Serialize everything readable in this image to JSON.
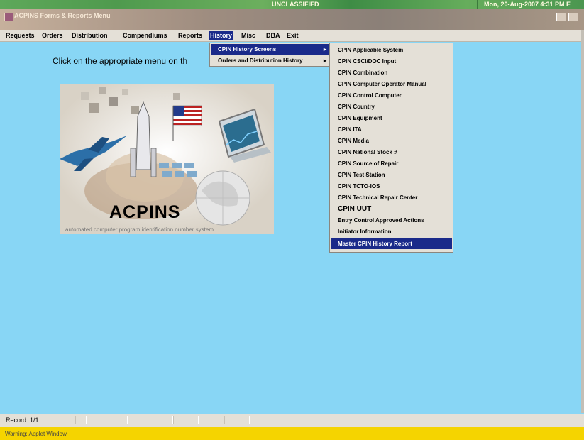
{
  "banner": {
    "classification": "UNCLASSIFIED",
    "datetime": "Mon, 20-Aug-2007 4:31 PM E"
  },
  "window": {
    "title": "ACPINS Forms & Reports Menu"
  },
  "menubar": [
    {
      "label": "Requests"
    },
    {
      "label": "Orders"
    },
    {
      "label": "Distribution"
    },
    {
      "label": "Compendiums"
    },
    {
      "label": "Reports"
    },
    {
      "label": "History"
    },
    {
      "label": "Misc"
    },
    {
      "label": "DBA"
    },
    {
      "label": "Exit"
    }
  ],
  "main": {
    "instruction": "Click on the appropriate menu on th"
  },
  "logo": {
    "name": "ACPINS",
    "tagline": "automated computer program identification number system"
  },
  "history_menu": [
    {
      "label": "CPIN History Screens",
      "arrow": "▸"
    },
    {
      "label": "Orders and Distribution History",
      "arrow": "▸"
    }
  ],
  "submenu": [
    "CPIN Applicable System",
    "CPIN CSCI/DOC Input",
    "CPIN Combination",
    "CPIN Computer Operator Manual",
    "CPIN Control Computer",
    "CPIN Country",
    "CPIN Equipment",
    "CPIN ITA",
    "CPIN Media",
    "CPIN National Stock #",
    "CPIN Source of Repair",
    "CPIN Test Station",
    "CPIN TCTO-IOS",
    "CPIN Technical Repair Center",
    "CPIN UUT",
    "Entry Control Approved Actions",
    "Initiator Information",
    "Master CPIN History Report"
  ],
  "status": {
    "record": "Record: 1/1"
  },
  "warning": "Warning: Applet Window",
  "colors": {
    "background": "#88d6f5",
    "highlight": "#1a2a8a",
    "warning": "#f5d400"
  }
}
